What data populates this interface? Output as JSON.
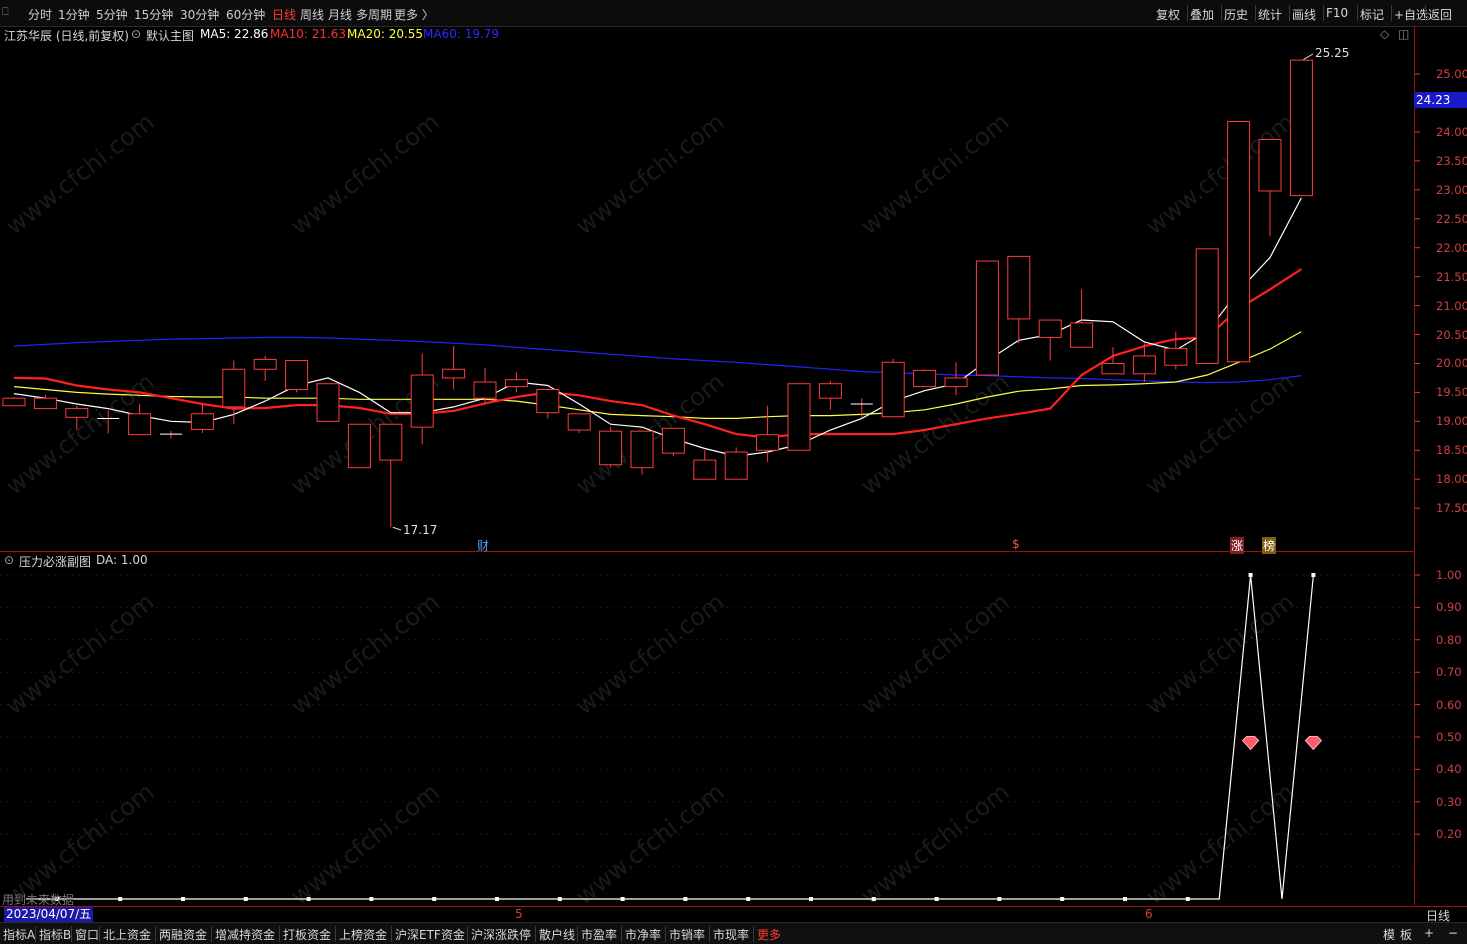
{
  "toolbar": {
    "left_items": [
      "分时",
      "1分钟",
      "5分钟",
      "15分钟",
      "30分钟",
      "60分钟",
      "日线",
      "周线",
      "月线",
      "多周期",
      "更多 〉"
    ],
    "active_left": "日线",
    "right_items": [
      "复权",
      "叠加",
      "历史",
      "统计",
      "画线",
      "F10",
      "标记",
      "+自选",
      "返回"
    ]
  },
  "main_header": {
    "stock_name": "江苏华辰 (日线,前复权)",
    "chart_template": "默认主图",
    "ma5_label": "MA5: 22.86",
    "ma10_label": "MA10: 21.63",
    "ma20_label": "MA20: 20.55",
    "ma60_label": "MA60: 19.79"
  },
  "sub_header": {
    "title": "压力必涨副图",
    "da_label": "DA: 1.00"
  },
  "colors": {
    "up": "#ff3b3b",
    "down": "#00ffff",
    "ma5": "#ffffff",
    "ma10": "#ff2020",
    "ma20": "#ffff40",
    "ma60": "#2222ff",
    "axis": "#d04040"
  },
  "price_axis": [
    "25.00",
    "24.50",
    "24.00",
    "23.50",
    "23.00",
    "22.50",
    "22.00",
    "21.50",
    "21.00",
    "20.50",
    "20.00",
    "19.50",
    "19.00",
    "18.50",
    "18.00",
    "17.50"
  ],
  "current_price": "24.23",
  "high_label": "25.25",
  "low_label": "17.17",
  "event_markers": [
    "财",
    "$",
    "涨",
    "榜"
  ],
  "sub_axis": [
    "1.00",
    "0.90",
    "0.80",
    "0.70",
    "0.60",
    "0.50",
    "0.40",
    "0.30",
    "0.20"
  ],
  "future_data_note": "用到未来数据",
  "dates": {
    "current": "2023/04/07/五",
    "month_5": "5",
    "month_6": "6",
    "period": "日线"
  },
  "bottom_tabs": [
    "指标A",
    "指标B",
    "窗口",
    "北上资金",
    "两融资金",
    "增减持资金",
    "打板资金",
    "上榜资金",
    "沪深ETF资金",
    "沪深涨跌停",
    "散户线",
    "市盈率",
    "市净率",
    "市销率",
    "市现率",
    "更多"
  ],
  "bottom_right": [
    "模",
    "板",
    "+",
    "−"
  ],
  "watermark": "www.cfchi.com",
  "chart_data": {
    "type": "candlestick",
    "ylim": [
      16.95,
      25.45
    ],
    "candles": [
      {
        "o": 19.27,
        "c": 19.4,
        "h": 19.42,
        "l": 19.27
      },
      {
        "o": 19.22,
        "c": 19.4,
        "h": 19.46,
        "l": 19.22
      },
      {
        "o": 19.07,
        "c": 19.22,
        "h": 19.27,
        "l": 18.85
      },
      {
        "o": 19.05,
        "c": 19.05,
        "h": 19.19,
        "l": 18.79
      },
      {
        "o": 18.77,
        "c": 19.13,
        "h": 19.3,
        "l": 18.77
      },
      {
        "o": 18.78,
        "c": 18.78,
        "h": 18.83,
        "l": 18.7
      },
      {
        "o": 18.86,
        "c": 19.13,
        "h": 19.3,
        "l": 18.8
      },
      {
        "o": 19.25,
        "c": 19.9,
        "h": 20.05,
        "l": 18.95
      },
      {
        "o": 19.9,
        "c": 20.07,
        "h": 20.13,
        "l": 19.7
      },
      {
        "o": 19.55,
        "c": 20.05,
        "h": 20.05,
        "l": 19.5
      },
      {
        "o": 19.0,
        "c": 19.65,
        "h": 19.65,
        "l": 19.0
      },
      {
        "o": 18.2,
        "c": 18.95,
        "h": 18.95,
        "l": 18.2
      },
      {
        "o": 18.33,
        "c": 18.95,
        "h": 18.95,
        "l": 17.17
      },
      {
        "o": 18.9,
        "c": 19.8,
        "h": 20.17,
        "l": 18.6
      },
      {
        "o": 19.75,
        "c": 19.9,
        "h": 20.3,
        "l": 19.55
      },
      {
        "o": 19.4,
        "c": 19.68,
        "h": 19.92,
        "l": 19.3
      },
      {
        "o": 19.6,
        "c": 19.72,
        "h": 19.85,
        "l": 19.5
      },
      {
        "o": 19.15,
        "c": 19.55,
        "h": 19.55,
        "l": 19.05
      },
      {
        "o": 18.85,
        "c": 19.13,
        "h": 19.13,
        "l": 18.8
      },
      {
        "o": 18.25,
        "c": 18.83,
        "h": 18.9,
        "l": 18.2
      },
      {
        "o": 18.2,
        "c": 18.83,
        "h": 18.83,
        "l": 18.08
      },
      {
        "o": 18.45,
        "c": 18.88,
        "h": 18.88,
        "l": 18.4
      },
      {
        "o": 18.0,
        "c": 18.33,
        "h": 18.5,
        "l": 18.0
      },
      {
        "o": 18.0,
        "c": 18.47,
        "h": 18.55,
        "l": 18.0
      },
      {
        "o": 18.5,
        "c": 18.77,
        "h": 19.27,
        "l": 18.3
      },
      {
        "o": 18.5,
        "c": 19.65,
        "h": 19.65,
        "l": 18.5
      },
      {
        "o": 19.4,
        "c": 19.65,
        "h": 19.7,
        "l": 19.2
      },
      {
        "o": 19.28,
        "c": 19.3,
        "h": 19.4,
        "l": 19.05
      },
      {
        "o": 19.08,
        "c": 20.02,
        "h": 20.08,
        "l": 19.08
      },
      {
        "o": 19.6,
        "c": 19.88,
        "h": 19.9,
        "l": 19.6
      },
      {
        "o": 19.6,
        "c": 19.75,
        "h": 20.02,
        "l": 19.45
      },
      {
        "o": 19.8,
        "c": 21.77,
        "h": 21.77,
        "l": 19.8
      },
      {
        "o": 20.77,
        "c": 21.85,
        "h": 21.85,
        "l": 20.35
      },
      {
        "o": 20.45,
        "c": 20.75,
        "h": 20.75,
        "l": 20.05
      },
      {
        "o": 20.28,
        "c": 20.7,
        "h": 21.28,
        "l": 20.28
      },
      {
        "o": 19.82,
        "c": 20.0,
        "h": 20.28,
        "l": 19.82
      },
      {
        "o": 19.82,
        "c": 20.13,
        "h": 20.35,
        "l": 19.68
      },
      {
        "o": 19.97,
        "c": 20.26,
        "h": 20.55,
        "l": 19.9
      },
      {
        "o": 20.0,
        "c": 21.98,
        "h": 21.98,
        "l": 20.0
      },
      {
        "o": 20.03,
        "c": 24.18,
        "h": 24.18,
        "l": 20.03
      },
      {
        "o": 22.98,
        "c": 23.87,
        "h": 23.87,
        "l": 22.2
      },
      {
        "o": 22.9,
        "c": 25.24,
        "h": 25.25,
        "l": 22.9
      }
    ],
    "ma5": [
      19.48,
      19.4,
      19.3,
      19.22,
      19.1,
      19.0,
      18.98,
      19.12,
      19.35,
      19.62,
      19.75,
      19.5,
      19.15,
      19.15,
      19.25,
      19.4,
      19.68,
      19.62,
      19.3,
      18.95,
      18.9,
      18.7,
      18.53,
      18.4,
      18.47,
      18.6,
      18.85,
      19.05,
      19.35,
      19.53,
      19.65,
      20.05,
      20.4,
      20.5,
      20.75,
      20.72,
      20.37,
      20.23,
      20.55,
      21.25,
      21.83,
      22.86
    ],
    "ma10": [
      19.75,
      19.74,
      19.62,
      19.55,
      19.5,
      19.4,
      19.3,
      19.22,
      19.23,
      19.28,
      19.28,
      19.23,
      19.13,
      19.13,
      19.18,
      19.31,
      19.42,
      19.5,
      19.45,
      19.35,
      19.28,
      19.1,
      18.95,
      18.78,
      18.72,
      18.78,
      18.78,
      18.78,
      18.78,
      18.85,
      18.95,
      19.05,
      19.13,
      19.22,
      19.8,
      20.13,
      20.3,
      20.42,
      20.45,
      20.95,
      21.28,
      21.63
    ],
    "ma20": [
      19.6,
      19.55,
      19.5,
      19.47,
      19.45,
      19.43,
      19.42,
      19.42,
      19.4,
      19.4,
      19.4,
      19.38,
      19.38,
      19.38,
      19.38,
      19.38,
      19.35,
      19.28,
      19.2,
      19.12,
      19.1,
      19.08,
      19.05,
      19.05,
      19.08,
      19.1,
      19.1,
      19.12,
      19.15,
      19.2,
      19.3,
      19.42,
      19.52,
      19.56,
      19.62,
      19.63,
      19.65,
      19.68,
      19.8,
      20.02,
      20.25,
      20.55
    ],
    "ma60": [
      20.3,
      20.33,
      20.36,
      20.38,
      20.4,
      20.42,
      20.43,
      20.44,
      20.45,
      20.45,
      20.44,
      20.42,
      20.4,
      20.38,
      20.35,
      20.32,
      20.28,
      20.24,
      20.2,
      20.16,
      20.12,
      20.08,
      20.05,
      20.02,
      19.98,
      19.94,
      19.9,
      19.86,
      19.84,
      19.82,
      19.8,
      19.79,
      19.77,
      19.75,
      19.74,
      19.72,
      19.7,
      19.68,
      19.67,
      19.68,
      19.72,
      19.79
    ],
    "sub": {
      "ylim": [
        0.0,
        1.0
      ],
      "values": [
        0,
        0,
        0,
        0,
        0,
        0,
        0,
        0,
        0,
        0,
        0,
        0,
        0,
        0,
        0,
        0,
        0,
        0,
        0,
        0,
        0,
        0,
        0,
        0,
        0,
        0,
        0,
        0,
        0,
        0,
        0,
        0,
        0,
        0,
        0,
        0,
        0,
        0,
        0,
        1,
        0,
        1
      ],
      "gem_indices": [
        39,
        41
      ],
      "gem_value": 0.48
    }
  }
}
